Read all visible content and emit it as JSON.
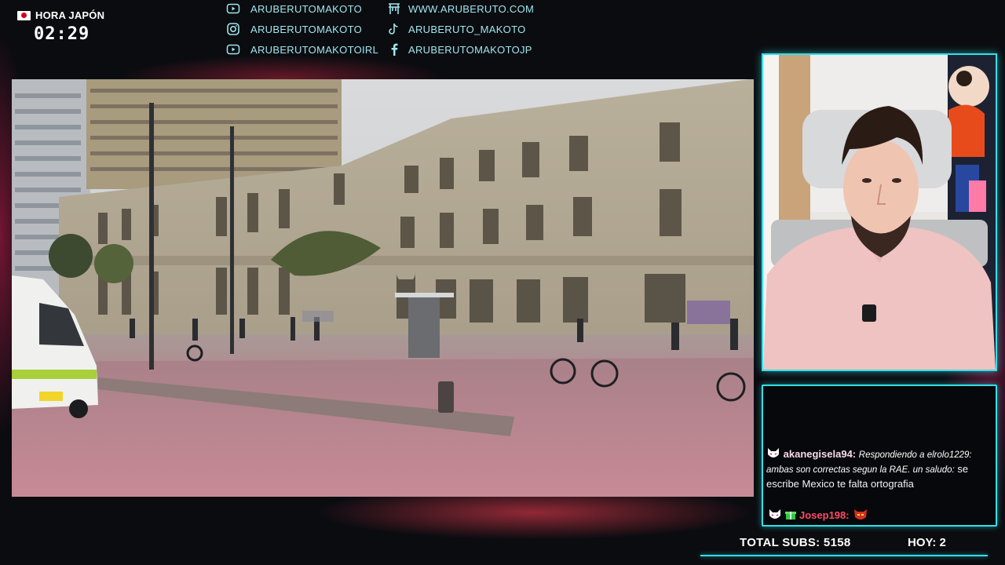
{
  "clock": {
    "label": "HORA JAPÓN",
    "time": "02:29",
    "flag_icon": "japan-flag-icon"
  },
  "socials": [
    {
      "icon": "youtube-icon",
      "handle": "ARUBERUTOMAKOTO"
    },
    {
      "icon": "website-icon",
      "handle": "WWW.ARUBERUTO.COM"
    },
    {
      "icon": "instagram-icon",
      "handle": "ARUBERUTOMAKOTO"
    },
    {
      "icon": "tiktok-icon",
      "handle": "ARUBERUTO_MAKOTO"
    },
    {
      "icon": "youtube-icon",
      "handle": "ARUBERUTOMAKOTOIRL"
    },
    {
      "icon": "facebook-icon",
      "handle": "ARUBERUTOMAKOTOJP"
    }
  ],
  "chat": {
    "messages": [
      {
        "user": "akanegisela94:",
        "reply": "Respondiendo a elrolo1229: ambas son correctas segun la RAE. un saludo:",
        "text": "se escribe Mexico te falta ortografia"
      },
      {
        "user": "Josep198:",
        "text": ""
      }
    ]
  },
  "stats": {
    "total_subs_label": "TOTAL SUBS: 5158",
    "today_label": "HOY: 2"
  },
  "colors": {
    "accent": "#32e0e8",
    "glow": "#e83c50",
    "social_text": "#9fe6ee"
  }
}
